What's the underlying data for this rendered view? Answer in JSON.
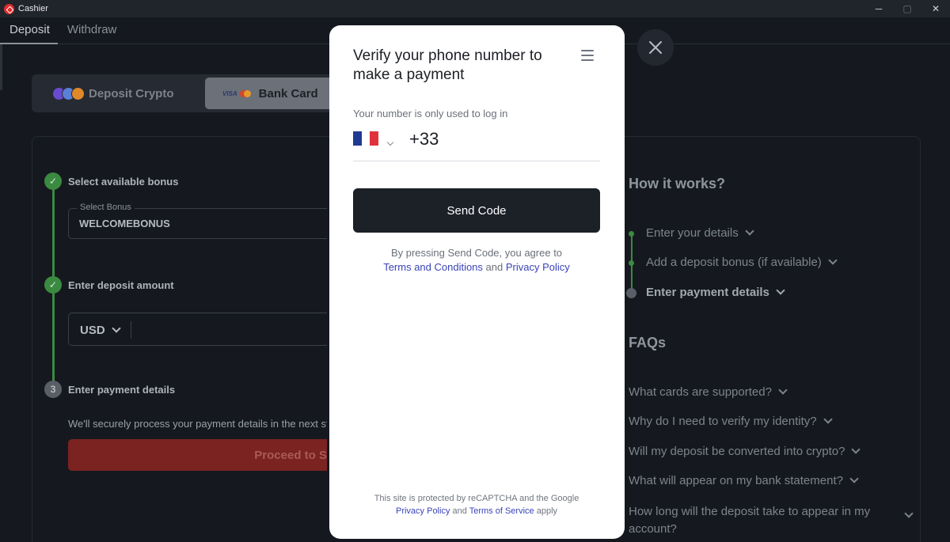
{
  "window": {
    "title": "Cashier",
    "minimize": "─",
    "maximize": "▢",
    "close": "✕"
  },
  "tabs": [
    {
      "label": "Deposit"
    },
    {
      "label": "Withdraw"
    }
  ],
  "methods": {
    "crypto": {
      "label": "Deposit Crypto"
    },
    "card": {
      "label": "Bank Card",
      "visa": "VISA"
    }
  },
  "steps": [
    {
      "number": "✓",
      "title": "Select available bonus"
    },
    {
      "number": "✓",
      "title": "Enter deposit amount"
    },
    {
      "number": "3",
      "title": "Enter payment details"
    }
  ],
  "bonus": {
    "legend": "Select Bonus",
    "value": "WELCOMEBONUS"
  },
  "amount": {
    "currency": "USD"
  },
  "payment": {
    "secure_text": "We'll securely process your payment details in the next step",
    "proceed_label": "Proceed to S"
  },
  "how": {
    "title": "How it works?",
    "items": [
      {
        "label": "Enter your details"
      },
      {
        "label": "Add a deposit bonus (if available)"
      },
      {
        "label": "Enter payment details"
      }
    ]
  },
  "faqs": {
    "title": "FAQs",
    "items": [
      {
        "q": "What cards are supported?"
      },
      {
        "q": "Why do I need to verify my identity?"
      },
      {
        "q": "Will my deposit be converted into crypto?"
      },
      {
        "q": "What will appear on my bank statement?"
      },
      {
        "q": "How long will the deposit take to appear in my account?"
      }
    ]
  },
  "modal": {
    "title": "Verify your phone number to make a payment",
    "subtitle": "Your number is only used to log in",
    "country_code": "+33",
    "send_label": "Send Code",
    "agree_prefix": "By pressing Send Code, you agree to",
    "terms_label": "Terms and Conditions",
    "and": "and",
    "privacy_label": "Privacy Policy",
    "recaptcha_text": "This site is protected by reCAPTCHA and the Google",
    "recaptcha_privacy": "Privacy Policy",
    "recaptcha_and": "and",
    "recaptcha_terms": "Terms of Service",
    "recaptcha_apply": "apply"
  },
  "colors": {
    "background": "#15191f",
    "success": "#3a8a40",
    "proceed": "#7b2320",
    "link": "#3a44b8",
    "send_button": "#1c2027"
  },
  "icons": {
    "app": "cashier-app-icon",
    "close": "close-icon",
    "menu": "menu-icon",
    "flag": "france-flag-icon"
  }
}
